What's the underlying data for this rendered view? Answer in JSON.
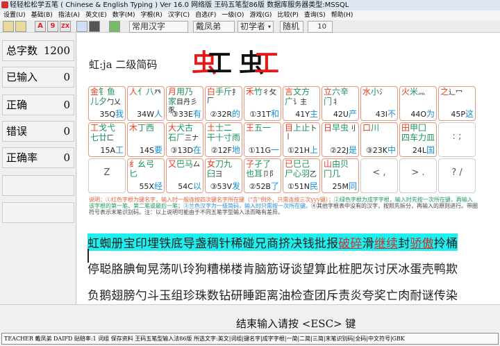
{
  "window": {
    "title": "轻轻松松学五笔 ( Chinese & English Typing ) Ver 16.0 网络版    王码五笔型86版   数据库服务器类型:MSSQL"
  },
  "menu": [
    "设置(U)",
    "基础(B)",
    "指法(A)",
    "英文(E)",
    "数字(M)",
    "字根(R)",
    "汉字(C)",
    "自选(F)",
    "一级(O)",
    "游戏(G)",
    "比较(P)",
    "查询(S)",
    "帮助(H)"
  ],
  "toolbar": {
    "buttons": [
      "open-icon",
      "folder-icon",
      "A",
      "9",
      "ZX",
      "search-doc-icon",
      "user-icon",
      "exit-icon"
    ],
    "text_set": "常用汉字",
    "user": "戴凤弟",
    "level": "初学者",
    "order": "随机",
    "count": "10"
  },
  "stats": [
    {
      "label": "总字数",
      "value": "1200"
    },
    {
      "label": "已输入",
      "value": "0"
    },
    {
      "label": "正确",
      "value": "0"
    },
    {
      "label": "错误",
      "value": "0"
    },
    {
      "label": "正确率",
      "value": "0"
    }
  ],
  "current": {
    "hint": "虹:ja 二级简码",
    "char_left": "虫",
    "char_right": "工"
  },
  "keys": [
    {
      "r": "金",
      "g": "钅鱼儿夕",
      "o": "勹乂",
      "code": "35Q",
      "ch": "我"
    },
    {
      "r": "人",
      "g": "亻八",
      "o": "癶",
      "code": "34W",
      "ch": "人"
    },
    {
      "r": "月",
      "g": "用乃家",
      "o": "目丹彡豕",
      "code": "③33E",
      "ch": "有"
    },
    {
      "r": "白",
      "g": "手斤",
      "o": "扌厂",
      "code": "②32R",
      "ch": "的"
    },
    {
      "r": "禾",
      "g": "竹",
      "o": "彳攵",
      "code": "①31T",
      "ch": "和"
    },
    {
      "r": "言",
      "g": "文方广",
      "o": "讠主",
      "code": "41Y",
      "ch": "主"
    },
    {
      "r": "立",
      "g": "六辛门",
      "o": "丬",
      "code": "42U",
      "ch": "产"
    },
    {
      "r": "水",
      "g": "小",
      "o": "氵",
      "code": "43I",
      "ch": "不"
    },
    {
      "r": "火",
      "g": "米",
      "o": "灬",
      "code": "44O",
      "ch": "为"
    },
    {
      "r": "之",
      "g": "",
      "o": "辶冖",
      "code": "45P",
      "ch": "这"
    },
    {
      "r": "工",
      "g": "戈弋七廿",
      "o": "匚",
      "code": "15A",
      "ch": "工"
    },
    {
      "r": "木",
      "g": "丁西",
      "o": "",
      "code": "14S",
      "ch": "要"
    },
    {
      "r": "大",
      "g": "犬古石厂",
      "o": "三ナ",
      "code": "③13D",
      "ch": "在"
    },
    {
      "r": "土",
      "g": "士二干十寸雨",
      "o": "",
      "code": "②12F",
      "ch": "地"
    },
    {
      "r": "王",
      "g": "五一",
      "o": "",
      "code": "①11G",
      "ch": "一"
    },
    {
      "r": "目",
      "g": "上止",
      "o": "卜丨",
      "code": "①21H",
      "ch": "上"
    },
    {
      "r": "日",
      "g": "早虫",
      "o": "刂",
      "code": "②22J",
      "ch": "是"
    },
    {
      "r": "口",
      "g": "川",
      "o": "",
      "code": "③23K",
      "ch": "中"
    },
    {
      "r": "田",
      "g": "甲囗四车力皿",
      "o": "",
      "code": "24L",
      "ch": "国"
    },
    {
      "sym": ": ;"
    },
    {
      "sym": "Z"
    },
    {
      "r": "纟",
      "g": "幺弓匕",
      "o": "",
      "code": "55X",
      "ch": "经"
    },
    {
      "r": "又",
      "g": "巴马",
      "o": "厶",
      "code": "54C",
      "ch": "以"
    },
    {
      "r": "女",
      "g": "刀九臼",
      "o": "彐",
      "code": "③53V",
      "ch": "发"
    },
    {
      "r": "子",
      "g": "孑了也耳",
      "o": "卩阝",
      "code": "②52B",
      "ch": "了"
    },
    {
      "r": "已",
      "g": "巳己尸心羽",
      "o": "乙",
      "code": "①51N",
      "ch": "民"
    },
    {
      "r": "山",
      "g": "由贝冂几",
      "o": "",
      "code": "25M",
      "ch": "同"
    },
    {
      "sym": "< ,"
    },
    {
      "sym": "> ."
    },
    {
      "sym": "? /"
    }
  ],
  "note": {
    "p1": "说明：①红色字根为键名字，输入时一般连按四次键名字所在键（\"言\"例外，只需连按三次yyy键）；",
    "p2": "②绿色字根为成字字根，输入时先按一次所在键，再输入该字根的第一笔、第二笔或最后一笔；",
    "p3": "③兰色汉字为一级简码，输入时只需按一次所在键。",
    "p4": "④其他字根表中没有的汉字，按照先拆分，再输入的原则进行。带圈符号表示末笔识别码。注：以上说明可能由于不同五笔字型输入法而略有差异。"
  },
  "text": {
    "line1a": "虹蜘册宝印埋铁底导盏稠针稀碰兄商挤决钱批报",
    "line1u1": "破碎",
    "line1b": "滑",
    "line1u2": "继续",
    "line1c": "封",
    "line1u3": "骄傲",
    "line1d": "拎桶",
    "line2": "停聪胳腆甸晃荡叭玲狗糟梯楼肯脑筋讶谈望算此桩肥灰讨厌冰蛋壳鸭欺",
    "line3": "负鹅翅膀勺斗玉组珍珠数钻研睡距离油检查团斥责炎夸奖亡肉耐谜传染"
  },
  "footer": {
    "esc": "结束输入请按 <ESC> 键",
    "status": "TEACHER 戴凤弟 DAIFD    贴赔率:1 词组 保存资料 王码五笔型输入法86版 所选文字:英文|词组|键名字|成字字根|一简|二简|三简|末笔识别码|全码|中文符号|GBK"
  }
}
